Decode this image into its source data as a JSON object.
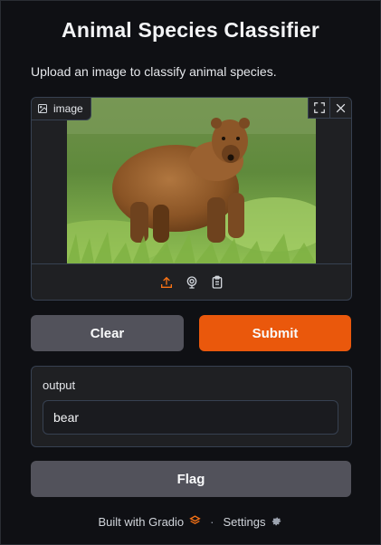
{
  "header": {
    "title": "Animal Species Classifier",
    "description": "Upload an image to classify animal species."
  },
  "image_input": {
    "label": "image",
    "label_icon": "image-icon",
    "top_actions": [
      "fullscreen-icon",
      "close-icon"
    ],
    "toolbar": [
      "upload-icon",
      "webcam-icon",
      "clipboard-icon"
    ],
    "photo_subject": "bear"
  },
  "actions": {
    "clear_label": "Clear",
    "submit_label": "Submit",
    "flag_label": "Flag"
  },
  "output": {
    "label": "output",
    "value": "bear"
  },
  "footer": {
    "built_with": "Built with Gradio",
    "separator": "·",
    "settings": "Settings"
  },
  "colors": {
    "background": "#0f1014",
    "panel": "#1f2023",
    "border": "#374151",
    "primary": "#ea580c",
    "secondary": "#52525b",
    "accent_icon": "#f97316"
  }
}
